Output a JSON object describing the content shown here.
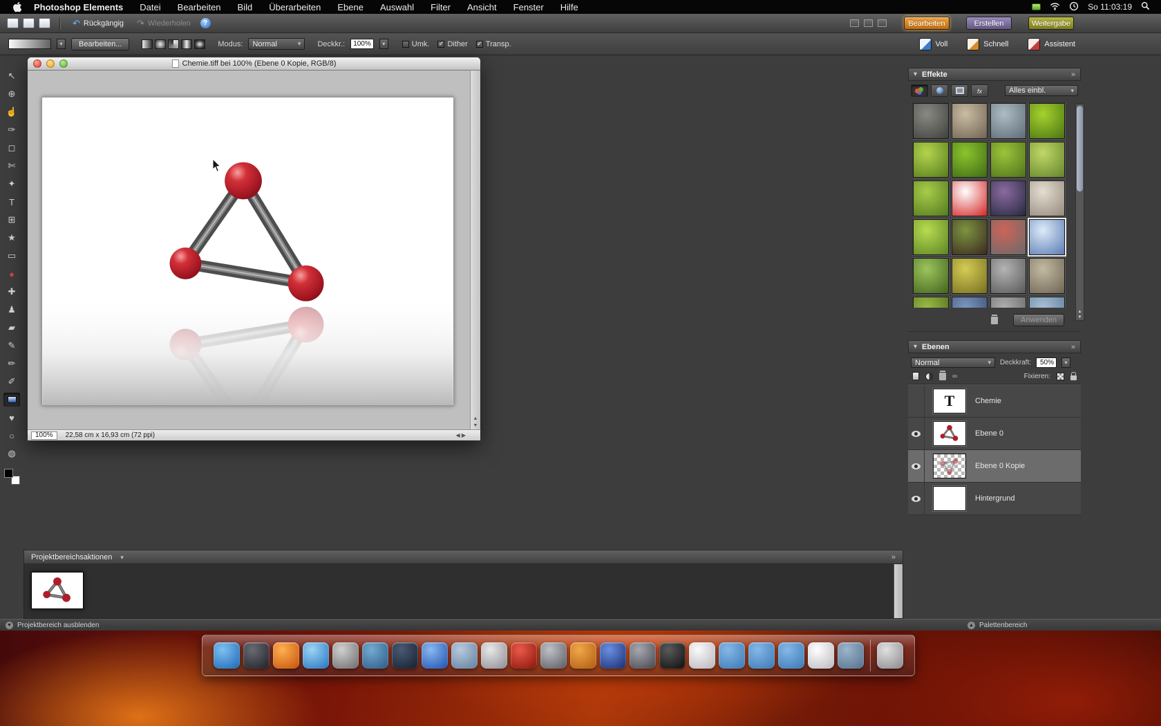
{
  "menubar": {
    "app_name": "Photoshop Elements",
    "items": [
      "Datei",
      "Bearbeiten",
      "Bild",
      "Überarbeiten",
      "Ebene",
      "Auswahl",
      "Filter",
      "Ansicht",
      "Fenster",
      "Hilfe"
    ],
    "clock": "So 11:03:19"
  },
  "shortcutbar": {
    "file_icons": [
      "new-document",
      "open-document",
      "save-document"
    ],
    "undo_label": "Rückgängig",
    "redo_label": "Wiederholen",
    "window_icons": [
      "arrange-cascade",
      "arrange-grid",
      "arrange-single"
    ],
    "tabs": [
      {
        "id": "bearbeiten",
        "label": "Bearbeiten",
        "color": "#e6931f",
        "active": true
      },
      {
        "id": "erstellen",
        "label": "Erstellen",
        "color": "#7a6c9e",
        "active": false
      },
      {
        "id": "weitergabe",
        "label": "Weitergabe",
        "color": "#9a9a2e",
        "active": false
      }
    ]
  },
  "optionsbar": {
    "edit_button": "Bearbeiten...",
    "gradient_types": [
      "linear",
      "radial",
      "angle",
      "reflected",
      "diamond"
    ],
    "mode_label": "Modus:",
    "mode_value": "Normal",
    "opacity_label": "Deckkr.:",
    "opacity_value": "100%",
    "checkboxes": [
      {
        "label": "Umk.",
        "checked": false
      },
      {
        "label": "Dither",
        "checked": true
      },
      {
        "label": "Transp.",
        "checked": true
      }
    ],
    "edit_modes": [
      {
        "label": "Voll",
        "active": true
      },
      {
        "label": "Schnell",
        "active": false
      },
      {
        "label": "Assistent",
        "active": false
      }
    ]
  },
  "tools": [
    {
      "name": "move",
      "glyph": "↖"
    },
    {
      "name": "zoom",
      "glyph": "⊕"
    },
    {
      "name": "hand",
      "glyph": "☝"
    },
    {
      "name": "eyedropper",
      "glyph": "✑"
    },
    {
      "name": "marquee",
      "glyph": "◻"
    },
    {
      "name": "lasso",
      "glyph": "✄"
    },
    {
      "name": "quick-selection",
      "glyph": "✦"
    },
    {
      "name": "type",
      "glyph": "T"
    },
    {
      "name": "crop",
      "glyph": "⊞"
    },
    {
      "name": "cookie-cutter",
      "glyph": "★"
    },
    {
      "name": "straighten",
      "glyph": "▭"
    },
    {
      "name": "red-eye",
      "glyph": "●",
      "color": "#c84545"
    },
    {
      "name": "healing-brush",
      "glyph": "✚"
    },
    {
      "name": "clone-stamp",
      "glyph": "♟"
    },
    {
      "name": "eraser",
      "glyph": "▰"
    },
    {
      "name": "brush",
      "glyph": "✎"
    },
    {
      "name": "pencil",
      "glyph": "✏"
    },
    {
      "name": "smart-brush",
      "glyph": "✐"
    },
    {
      "name": "gradient",
      "glyph": "",
      "active": true
    },
    {
      "name": "shape",
      "glyph": "♥"
    },
    {
      "name": "blur",
      "glyph": "○"
    },
    {
      "name": "sponge",
      "glyph": "◍"
    }
  ],
  "document": {
    "title": "Chemie.tiff bei 100% (Ebene 0 Kopie, RGB/8)",
    "zoom": "100%",
    "size_info": "22,58 cm x 16,93 cm (72 ppi)"
  },
  "effects": {
    "title": "Effekte",
    "toolbar_icons": [
      "filters",
      "layer-styles",
      "photo-effects",
      "all"
    ],
    "filter_value": "Alles einbl.",
    "apply_label": "Anwenden",
    "thumbs": [
      {
        "c1": "#8a8a84",
        "c2": "#3f3f3c"
      },
      {
        "c1": "#cbbda3",
        "c2": "#6e6353"
      },
      {
        "c1": "#aebcc4",
        "c2": "#5c6b74"
      },
      {
        "c1": "#a6d22e",
        "c2": "#4a7412"
      },
      {
        "c1": "#b4d44e",
        "c2": "#567c1e"
      },
      {
        "c1": "#8cc42e",
        "c2": "#3f6a14"
      },
      {
        "c1": "#9cc43a",
        "c2": "#4f721c"
      },
      {
        "c1": "#c0d868",
        "c2": "#63842a"
      },
      {
        "c1": "#a8cc48",
        "c2": "#547a20"
      },
      {
        "c1": "#ffffff",
        "c2": "#d42424"
      },
      {
        "c1": "#8a6aa0",
        "c2": "#26283e"
      },
      {
        "c1": "#e4ddd2",
        "c2": "#93897a"
      },
      {
        "c1": "#b8dc50",
        "c2": "#5c8424"
      },
      {
        "c1": "#7c9440",
        "c2": "#3c2820"
      },
      {
        "c1": "#cc6458",
        "c2": "#6a6a6a"
      },
      {
        "c1": "#dcebf8",
        "c2": "#5a7ab2",
        "selected": true
      },
      {
        "c1": "#9cc45c",
        "c2": "#42641e"
      },
      {
        "c1": "#d4cc54",
        "c2": "#776e22"
      },
      {
        "c1": "#b4b4b4",
        "c2": "#585858"
      },
      {
        "c1": "#c4baa2",
        "c2": "#6c6454"
      },
      {
        "c1": "#9cbc44",
        "c2": "#4c681c"
      },
      {
        "c1": "#7c98c0",
        "c2": "#36486a"
      },
      {
        "c1": "#b0b0b0",
        "c2": "#606060"
      },
      {
        "c1": "#a8c0d4",
        "c2": "#58789a"
      }
    ]
  },
  "layers": {
    "title": "Ebenen",
    "blend_value": "Normal",
    "opacity_label": "Deckkraft:",
    "opacity_value": "50%",
    "toolbar_icons": [
      "new-layer",
      "new-adjustment-layer",
      "delete-layer",
      "link-layers"
    ],
    "lock_label": "Fixieren:",
    "items": [
      {
        "name": "Chemie",
        "thumb": "text",
        "thumb_glyph": "T",
        "visible": false,
        "selected": false
      },
      {
        "name": "Ebene 0",
        "thumb": "molecule",
        "visible": true,
        "selected": false
      },
      {
        "name": "Ebene 0 Kopie",
        "thumb": "reflection",
        "visible": true,
        "selected": true
      },
      {
        "name": "Hintergrund",
        "thumb": "white",
        "visible": true,
        "selected": false
      }
    ]
  },
  "project_bin": {
    "title": "Projektbereichsaktionen",
    "hide_label": "Projektbereich ausblenden",
    "palette_label": "Palettenbereich"
  },
  "dock": {
    "icons": [
      {
        "name": "finder",
        "c1": "#7ec0f0",
        "c2": "#1a66b4"
      },
      {
        "name": "dashboard",
        "c1": "#6a6a72",
        "c2": "#1e1e26"
      },
      {
        "name": "firefox",
        "c1": "#ffb050",
        "c2": "#c4500a"
      },
      {
        "name": "itunes",
        "c1": "#9cd4f4",
        "c2": "#2272c0"
      },
      {
        "name": "iphoto",
        "c1": "#d0d0d0",
        "c2": "#6a6a6a"
      },
      {
        "name": "keynote",
        "c1": "#74aad0",
        "c2": "#2a5a86"
      },
      {
        "name": "mail-dark",
        "c1": "#4a5a72",
        "c2": "#141e2e"
      },
      {
        "name": "safari",
        "c1": "#8ab8f0",
        "c2": "#1a50b0"
      },
      {
        "name": "mail",
        "c1": "#b8cade",
        "c2": "#607e9c"
      },
      {
        "name": "design-tool",
        "c1": "#e8e8e8",
        "c2": "#8a8a92"
      },
      {
        "name": "dvd-player",
        "c1": "#e85a4a",
        "c2": "#8a1208"
      },
      {
        "name": "system-preferences",
        "c1": "#c0c0c8",
        "c2": "#585860"
      },
      {
        "name": "network-globe",
        "c1": "#f0a848",
        "c2": "#b05a10"
      },
      {
        "name": "time-machine",
        "c1": "#6a90e0",
        "c2": "#182a70"
      },
      {
        "name": "photo-booth",
        "c1": "#a8a8b0",
        "c2": "#44444c"
      },
      {
        "name": "unity",
        "c1": "#5a5a5a",
        "c2": "#0c0c0c"
      },
      {
        "name": "white-app",
        "c1": "#fafafa",
        "c2": "#b4b4bc"
      },
      {
        "name": "folder-applications",
        "c1": "#84b8e8",
        "c2": "#3a78b4"
      },
      {
        "name": "folder-documents",
        "c1": "#84b8e8",
        "c2": "#3a78b4"
      },
      {
        "name": "folder-downloads",
        "c1": "#84b8e8",
        "c2": "#3a78b4"
      },
      {
        "name": "textedit",
        "c1": "#ffffff",
        "c2": "#b8b8c0"
      },
      {
        "name": "stack",
        "c1": "#9cb4cc",
        "c2": "#54708c"
      },
      {
        "sep": true
      },
      {
        "name": "trash",
        "c1": "#e0e0e0",
        "c2": "#88888c"
      }
    ]
  }
}
